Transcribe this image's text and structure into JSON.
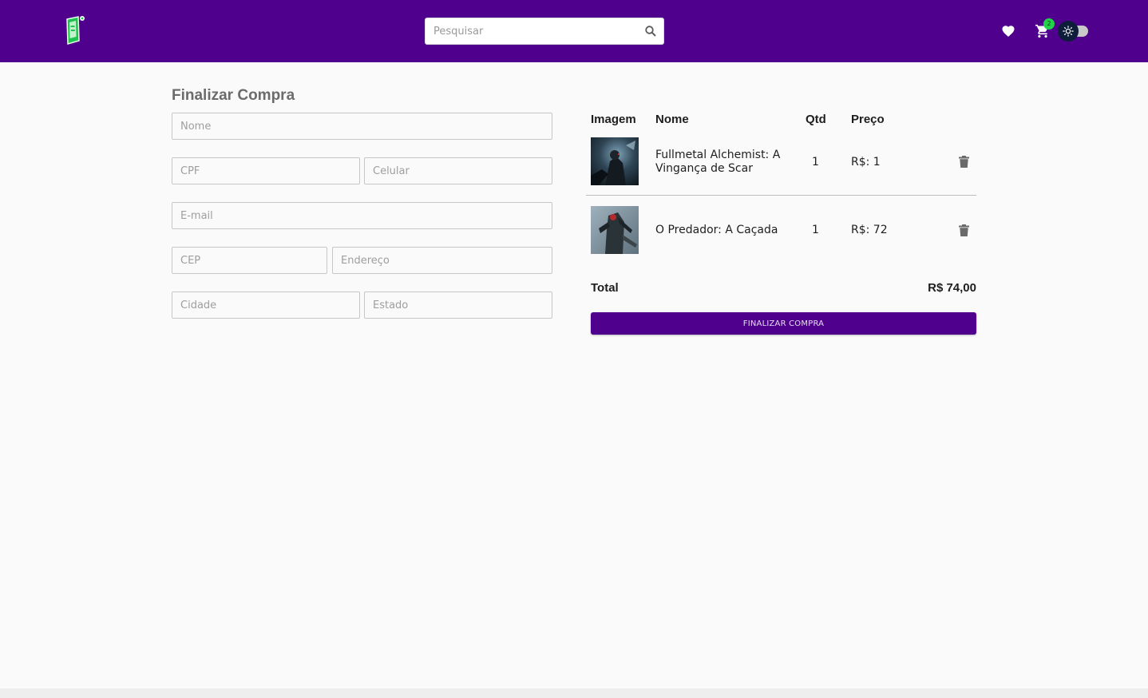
{
  "header": {
    "search_placeholder": "Pesquisar",
    "cart_count": "2",
    "accent_color": "#4f008c",
    "icons": [
      "logo-icon",
      "search-icon",
      "heart-icon",
      "cart-icon",
      "sun-icon"
    ]
  },
  "form": {
    "title": "Finalizar Compra",
    "fields": {
      "nome": "Nome",
      "cpf": "CPF",
      "celular": "Celular",
      "email": "E-mail",
      "cep": "CEP",
      "endereco": "Endereço",
      "cidade": "Cidade",
      "estado": "Estado"
    }
  },
  "cart": {
    "columns": [
      "Imagem",
      "Nome",
      "Qtd",
      "Preço"
    ],
    "items": [
      {
        "name": "Fullmetal Alchemist: A Vingança de Scar",
        "qty": "1",
        "price": "R$: 1"
      },
      {
        "name": "O Predador: A Caçada",
        "qty": "1",
        "price": "R$: 72"
      }
    ],
    "total_label": "Total",
    "total_value": "R$ 74,00",
    "button_label": "FINALIZAR COMPRA"
  }
}
